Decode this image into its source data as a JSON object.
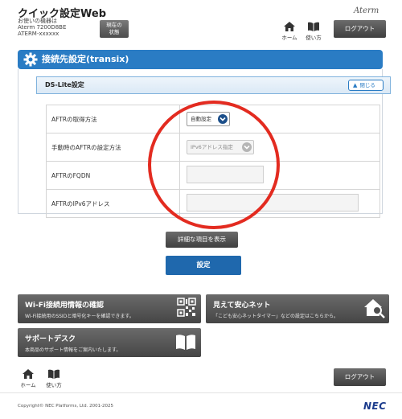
{
  "header": {
    "app_title": "クイック設定Web",
    "device_lines": [
      "お使いの機器は",
      "Aterm 7200D8BE",
      "ATERM-xxxxxx"
    ],
    "status_button_lines": [
      "現在の",
      "状態"
    ],
    "brand": "Aterm",
    "home_label": "ホーム",
    "help_label": "使い方",
    "logout_label": "ログアウト"
  },
  "section": {
    "title": "接続先設定(transix)"
  },
  "ds_lite": {
    "title": "DS-Lite設定",
    "collapse_label": "閉じる",
    "rows": [
      {
        "label": "AFTRの取得方法",
        "value": "自動設定"
      },
      {
        "label": "手動時のAFTRの設定方法",
        "value": "IPv6アドレス指定"
      },
      {
        "label": "AFTRのFQDN",
        "value": ""
      },
      {
        "label": "AFTRのIPv6アドレス",
        "value": ""
      }
    ]
  },
  "actions": {
    "detail_label": "詳細な項目を表示",
    "apply_label": "設定"
  },
  "tiles": {
    "wifi": {
      "title": "Wi-Fi接続用情報の確認",
      "desc": "Wi-Fi接続用のSSIDと暗号化キーを確認できます。"
    },
    "anshin": {
      "title": "見えて安心ネット",
      "desc": "「こども安心ネットタイマー」などの設定はこちらから。"
    },
    "support": {
      "title": "サポートデスク",
      "desc": "本商品のサポート情報をご案内いたします。"
    }
  },
  "footer": {
    "home_label": "ホーム",
    "help_label": "使い方",
    "logout_label": "ログアウト",
    "copyright": "Copyright© NEC Platforms, Ltd. 2001-2025",
    "nec_logo": "NEC"
  },
  "colors": {
    "accent_blue": "#2a7cc4",
    "apply_blue": "#1f68ad",
    "annotation_red": "#e32b20",
    "dark_button": "#4d4d4d"
  }
}
